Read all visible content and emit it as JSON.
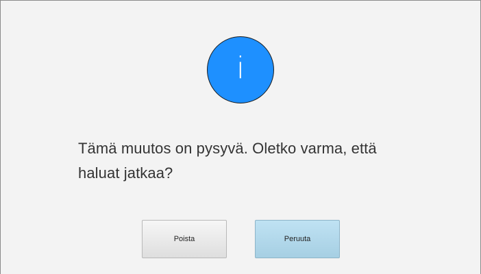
{
  "dialog": {
    "icon": {
      "name": "info-icon",
      "glyph": "i",
      "color": "#1e90ff"
    },
    "message": "Tämä muutos on pysyvä. Oletko varma, että haluat jatkaa?",
    "buttons": {
      "delete_label": "Poista",
      "cancel_label": "Peruuta"
    }
  },
  "colors": {
    "background": "#f3f3f3",
    "cancel_button": "#b4d9ec",
    "text": "#333333"
  }
}
